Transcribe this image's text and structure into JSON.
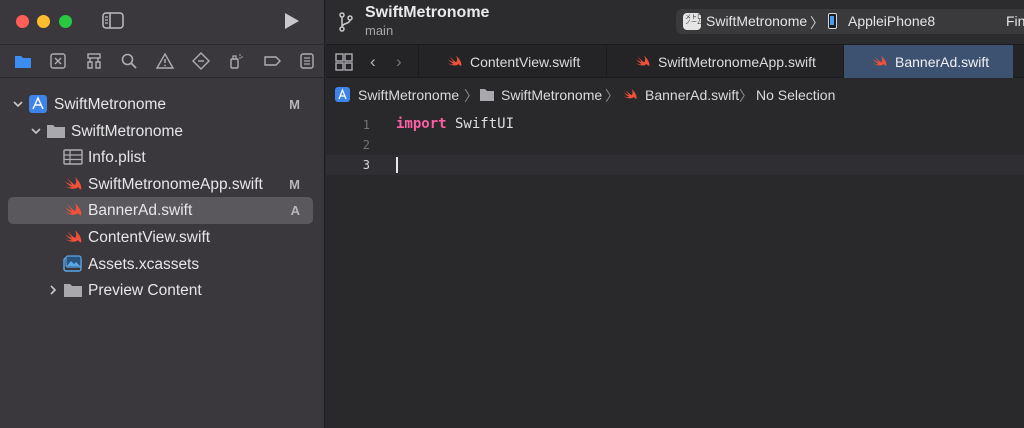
{
  "sidebar": {
    "nav_tabs": [
      {
        "icon": "folder-icon"
      },
      {
        "icon": "source-control-icon"
      },
      {
        "icon": "symbol-hierarchy-icon"
      },
      {
        "icon": "search-icon"
      },
      {
        "icon": "warning-icon"
      },
      {
        "icon": "test-diamond-icon"
      },
      {
        "icon": "debug-spray-icon"
      },
      {
        "icon": "breakpoint-icon"
      },
      {
        "icon": "report-icon"
      }
    ],
    "tree": [
      {
        "label": "SwiftMetronome",
        "badge": "M",
        "icon": "project-icon"
      },
      {
        "label": "SwiftMetronome",
        "badge": "",
        "icon": "folder-icon"
      },
      {
        "label": "Info.plist",
        "badge": "",
        "icon": "plist-icon"
      },
      {
        "label": "SwiftMetronomeApp.swift",
        "badge": "M",
        "icon": "swift-file-icon"
      },
      {
        "label": "BannerAd.swift",
        "badge": "A",
        "icon": "swift-file-icon",
        "selected": true
      },
      {
        "label": "ContentView.swift",
        "badge": "",
        "icon": "swift-file-icon"
      },
      {
        "label": "Assets.xcassets",
        "badge": "",
        "icon": "assets-icon"
      },
      {
        "label": "Preview Content",
        "badge": "",
        "icon": "folder-icon"
      }
    ]
  },
  "toolbar": {
    "project_title": "SwiftMetronome",
    "branch": "main",
    "scheme_icon_text": "メトロ\nノーム",
    "scheme_name": "SwiftMetronome",
    "scheme_separator": "〉",
    "device_name": "AppleiPhone8",
    "status_text": "Fin"
  },
  "tabs": [
    {
      "label": "ContentView.swift"
    },
    {
      "label": "SwiftMetronomeApp.swift"
    },
    {
      "label": "BannerAd.swift",
      "active": true
    }
  ],
  "jumpbar": {
    "items": [
      "SwiftMetronome",
      "SwiftMetronome",
      "BannerAd.swift",
      "No Selection"
    ],
    "separator": "〉"
  },
  "editor": {
    "lines": [
      {
        "number": "1",
        "keyword": "import",
        "text": " SwiftUI"
      },
      {
        "number": "2",
        "keyword": "",
        "text": ""
      },
      {
        "number": "3",
        "keyword": "",
        "text": ""
      }
    ]
  },
  "colors": {
    "accent_blue": "#4a9cf0",
    "swift_orange": "#f05138",
    "keyword_pink": "#fc5fa3",
    "active_tab": "#3d5171"
  }
}
